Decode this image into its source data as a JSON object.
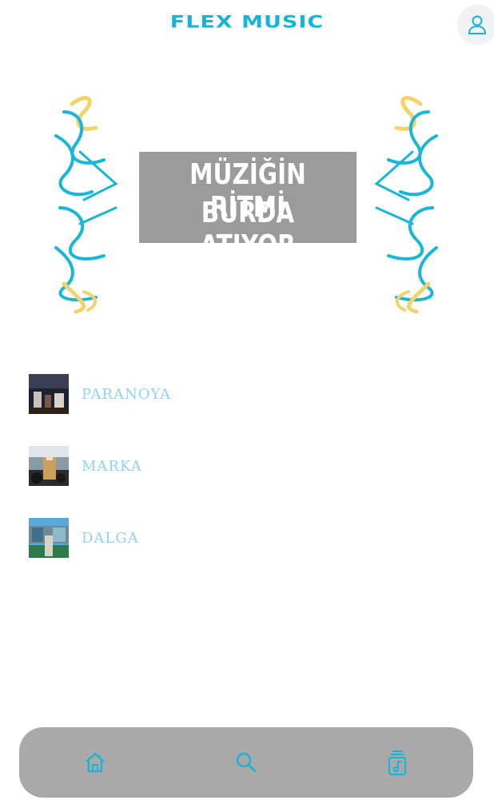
{
  "header": {
    "title": "FLEX MUSIC",
    "profile_icon": "user-icon"
  },
  "banner": {
    "line1": "MÜZİĞİN RİTMİ",
    "line2": "BURDA ATIYOR",
    "accent_colors": [
      "#18b6d8",
      "#f2d46a"
    ]
  },
  "tracks": [
    {
      "title": "PARANOYA",
      "thumb_colors": [
        "#3a2a22",
        "#1a1f2d"
      ]
    },
    {
      "title": "MARKA",
      "thumb_colors": [
        "#caa05a",
        "#6c7c86"
      ]
    },
    {
      "title": "DALGA",
      "thumb_colors": [
        "#5aa9d8",
        "#2f7a4a"
      ]
    }
  ],
  "bottom_nav": {
    "items": [
      {
        "icon": "home-icon"
      },
      {
        "icon": "search-icon"
      },
      {
        "icon": "playlist-icon"
      }
    ],
    "accent": "#16b4d8"
  },
  "colors": {
    "brand": "#16b4d8",
    "track_text": "#8ed4f0",
    "nav_bg": "#a9a9a9"
  }
}
